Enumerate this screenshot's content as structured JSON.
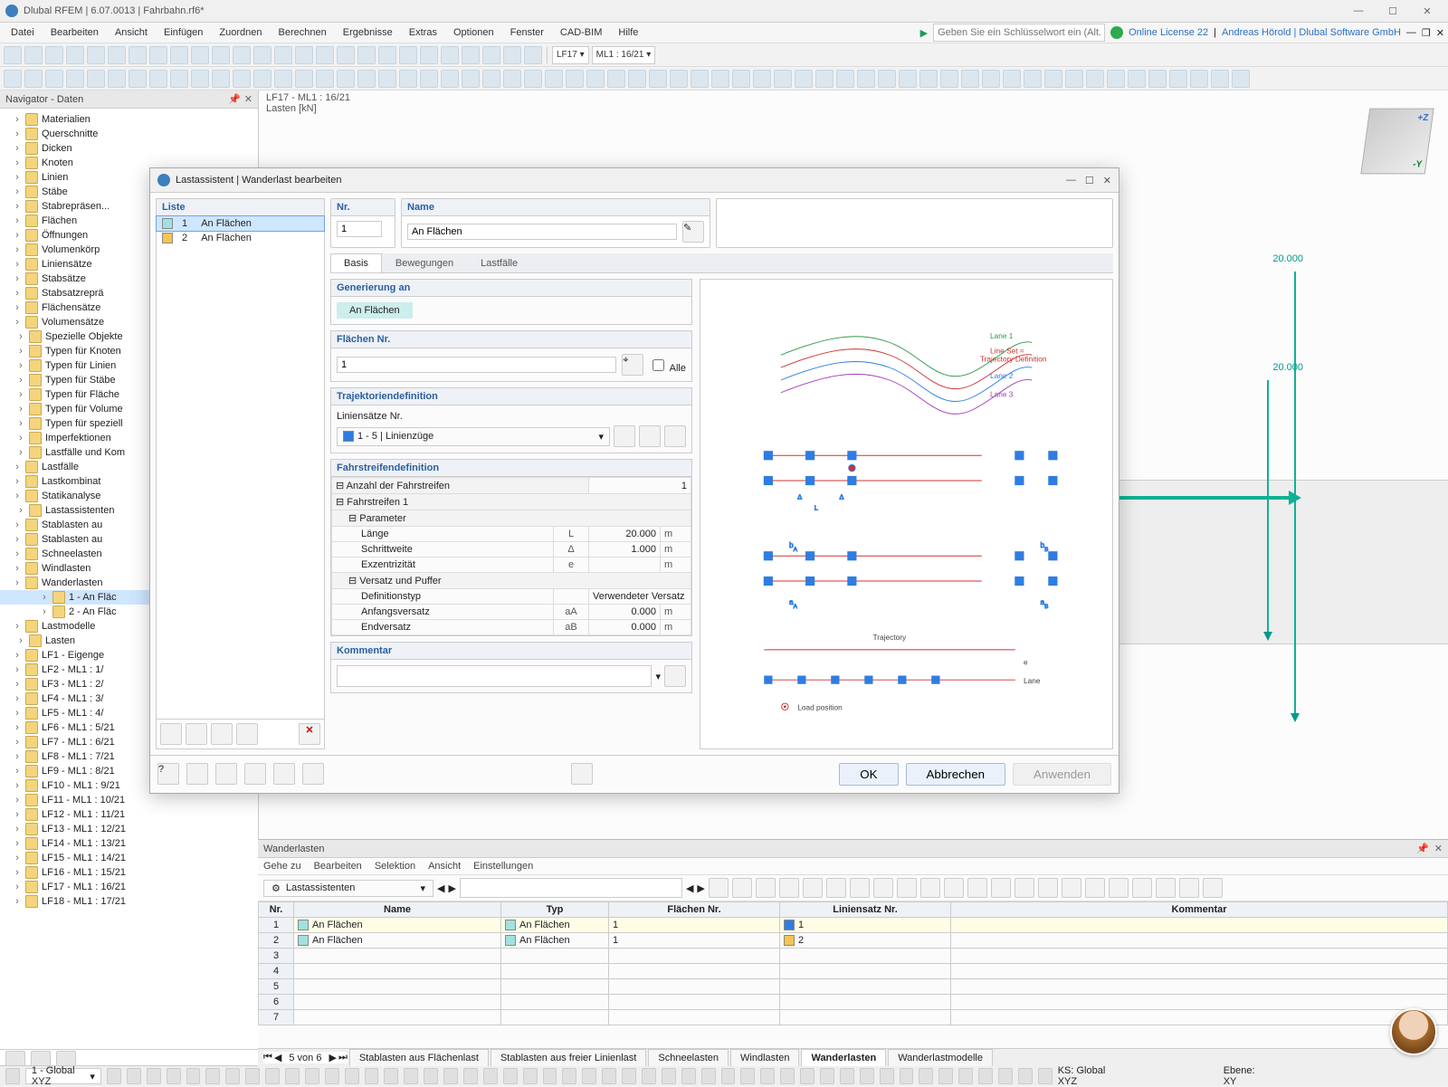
{
  "app": {
    "title": "Dlubal RFEM | 6.07.0013 | Fahrbahn.rf6*"
  },
  "menu": [
    "Datei",
    "Bearbeiten",
    "Ansicht",
    "Einfügen",
    "Zuordnen",
    "Berechnen",
    "Ergebnisse",
    "Extras",
    "Optionen",
    "Fenster",
    "CAD-BIM",
    "Hilfe"
  ],
  "searchPlaceholder": "Geben Sie ein Schlüsselwort ein (Alt...",
  "license": "Online License 22",
  "user": "Andreas Hörold | Dlubal Software GmbH",
  "toolbarCombos": {
    "lf": "LF17",
    "ml": "ML1 : 16/21"
  },
  "navigator": {
    "title": "Navigator - Daten",
    "items": [
      {
        "t": "Materialien"
      },
      {
        "t": "Querschnitte"
      },
      {
        "t": "Dicken"
      },
      {
        "t": "Knoten"
      },
      {
        "t": "Linien"
      },
      {
        "t": "Stäbe"
      },
      {
        "t": "Stabrepräsen..."
      },
      {
        "t": "Flächen"
      },
      {
        "t": "Öffnungen"
      },
      {
        "t": "Volumenkörp"
      },
      {
        "t": "Liniensätze"
      },
      {
        "t": "Stabsätze"
      },
      {
        "t": "Stabsatzreprä"
      },
      {
        "t": "Flächensätze"
      },
      {
        "t": "Volumensätze"
      }
    ],
    "folders": [
      "Spezielle Objekte",
      "Typen für Knoten",
      "Typen für Linien",
      "Typen für Stäbe",
      "Typen für Fläche",
      "Typen für Volume",
      "Typen für speziell",
      "Imperfektionen"
    ],
    "loadcases": {
      "title": "Lastfälle und Kom",
      "children": [
        "Lastfälle",
        "Lastkombinat",
        "Statikanalyse"
      ]
    },
    "wizards": {
      "title": "Lastassistenten",
      "children": [
        "Stablasten au",
        "Stablasten au",
        "Schneelasten",
        "Windlasten"
      ],
      "moving": {
        "title": "Wanderlasten",
        "children": [
          "1 - An Fläc",
          "2 - An Fläc"
        ],
        "sel": 0
      },
      "models": "Lastmodelle"
    },
    "loads": {
      "title": "Lasten",
      "children": [
        "LF1 - Eigenge",
        "LF2 - ML1 : 1/",
        "LF3 - ML1 : 2/",
        "LF4 - ML1 : 3/",
        "LF5 - ML1 : 4/",
        "LF6 - ML1 : 5/21",
        "LF7 - ML1 : 6/21",
        "LF8 - ML1 : 7/21",
        "LF9 - ML1 : 8/21",
        "LF10 - ML1 : 9/21",
        "LF11 - ML1 : 10/21",
        "LF12 - ML1 : 11/21",
        "LF13 - ML1 : 12/21",
        "LF14 - ML1 : 13/21",
        "LF15 - ML1 : 14/21",
        "LF16 - ML1 : 15/21",
        "LF17 - ML1 : 16/21",
        "LF18 - ML1 : 17/21"
      ]
    }
  },
  "view": {
    "header1": "LF17 - ML1 : 16/21",
    "header2": "Lasten [kN]",
    "dim": "20.000"
  },
  "modal": {
    "title": "Lastassistent | Wanderlast bearbeiten",
    "listHeader": "Liste",
    "listItems": [
      {
        "n": "1",
        "name": "An Flächen",
        "color": "#9fe2e0"
      },
      {
        "n": "2",
        "name": "An Flächen",
        "color": "#f3c64d"
      }
    ],
    "nrHeader": "Nr.",
    "nrVal": "1",
    "nameHeader": "Name",
    "nameVal": "An Flächen",
    "tabs": [
      "Basis",
      "Bewegungen",
      "Lastfälle"
    ],
    "activeTab": 0,
    "sections": {
      "gen": {
        "title": "Generierung an",
        "val": "An Flächen"
      },
      "surf": {
        "title": "Flächen Nr.",
        "val": "1",
        "all": "Alle"
      },
      "traj": {
        "title": "Trajektoriendefinition",
        "sub": "Liniensätze Nr.",
        "val": "1 - 5 | Linienzüge"
      },
      "lane": {
        "title": "Fahrstreifendefinition",
        "countLabel": "Anzahl der Fahrstreifen",
        "count": "1",
        "fs": "Fahrstreifen 1",
        "param": "Parameter",
        "rows": [
          {
            "label": "Länge",
            "sym": "L",
            "val": "20.000",
            "unit": "m"
          },
          {
            "label": "Schrittweite",
            "sym": "Δ",
            "val": "1.000",
            "unit": "m"
          },
          {
            "label": "Exzentrizität",
            "sym": "e",
            "val": "",
            "unit": "m"
          }
        ],
        "offset": "Versatz und Puffer",
        "rows2": [
          {
            "label": "Definitionstyp",
            "sym": "",
            "val": "Verwendeter Versatz",
            "unit": ""
          },
          {
            "label": "Anfangsversatz",
            "sym": "aA",
            "val": "0.000",
            "unit": "m"
          },
          {
            "label": "Endversatz",
            "sym": "aB",
            "val": "0.000",
            "unit": "m"
          }
        ]
      },
      "comment": {
        "title": "Kommentar"
      }
    },
    "diagram": {
      "lane1": "Lane 1",
      "lineSet": "Line Set =",
      "trajDef": "Trajectory Definition",
      "lane2": "Lane 2",
      "lane3": "Lane 3",
      "traj": "Trajectory",
      "lane": "Lane",
      "loadPos": "Load position"
    },
    "buttons": {
      "ok": "OK",
      "cancel": "Abbrechen",
      "apply": "Anwenden"
    }
  },
  "bottom": {
    "title": "Wanderlasten",
    "menu": [
      "Gehe zu",
      "Bearbeiten",
      "Selektion",
      "Ansicht",
      "Einstellungen"
    ],
    "combo": "Lastassistenten",
    "cols": [
      "Nr.",
      "Name",
      "Typ",
      "Flächen Nr.",
      "Liniensatz Nr.",
      "Kommentar"
    ],
    "rows": [
      {
        "n": "1",
        "name": "An Flächen",
        "typ": "An Flächen",
        "fl": "1",
        "ls": "1",
        "lscolor": "#2f7de0"
      },
      {
        "n": "2",
        "name": "An Flächen",
        "typ": "An Flächen",
        "fl": "1",
        "ls": "2",
        "lscolor": "#f3c64d"
      }
    ],
    "pager": "5 von 6",
    "tabs": [
      "Stablasten aus Flächenlast",
      "Stablasten aus freier Linienlast",
      "Schneelasten",
      "Windlasten",
      "Wanderlasten",
      "Wanderlastmodelle"
    ],
    "activeTab": 4
  },
  "status": {
    "cs": "1 - Global XYZ",
    "ks": "KS: Global XYZ",
    "ebene": "Ebene: XY"
  }
}
